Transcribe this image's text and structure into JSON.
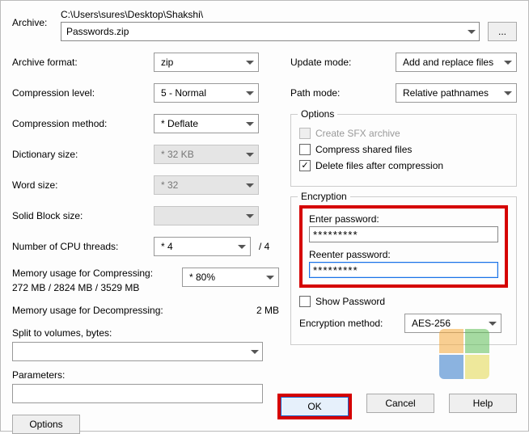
{
  "archive": {
    "label": "Archive:",
    "path_text": "C:\\Users\\sures\\Desktop\\Shakshi\\",
    "file": "Passwords.zip",
    "browse": "..."
  },
  "left": {
    "archive_format": {
      "label": "Archive format:",
      "value": "zip"
    },
    "compression_level": {
      "label": "Compression level:",
      "value": "5 - Normal"
    },
    "compression_method": {
      "label": "Compression method:",
      "value": "* Deflate"
    },
    "dictionary_size": {
      "label": "Dictionary size:",
      "value": "* 32 KB"
    },
    "word_size": {
      "label": "Word size:",
      "value": "* 32"
    },
    "solid_block_size": {
      "label": "Solid Block size:",
      "value": ""
    },
    "cpu_threads": {
      "label": "Number of CPU threads:",
      "value": "* 4",
      "max": "/ 4"
    },
    "mem_compress": {
      "label": "Memory usage for Compressing:",
      "detail": "272 MB / 2824 MB / 3529 MB",
      "value": "* 80%"
    },
    "mem_decompress": {
      "label": "Memory usage for Decompressing:",
      "value": "2 MB"
    },
    "split": {
      "label": "Split to volumes, bytes:"
    },
    "parameters": {
      "label": "Parameters:"
    },
    "options_btn": "Options"
  },
  "right": {
    "update_mode": {
      "label": "Update mode:",
      "value": "Add and replace files"
    },
    "path_mode": {
      "label": "Path mode:",
      "value": "Relative pathnames"
    },
    "options_group": "Options",
    "sfx": "Create SFX archive",
    "compress_shared": "Compress shared files",
    "delete_after": "Delete files after compression",
    "encryption_group": "Encryption",
    "enter_password": "Enter password:",
    "reenter_password": "Reenter password:",
    "masked": "*********",
    "show_password": "Show Password",
    "enc_method": {
      "label": "Encryption method:",
      "value": "AES-256"
    }
  },
  "buttons": {
    "ok": "OK",
    "cancel": "Cancel",
    "help": "Help"
  }
}
